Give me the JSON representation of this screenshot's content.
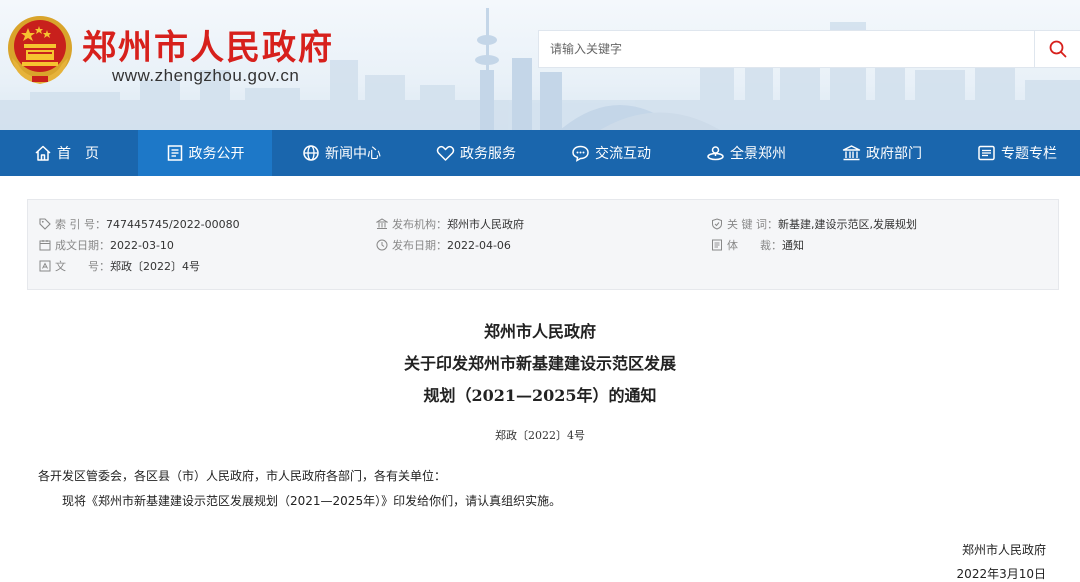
{
  "header": {
    "site_title": "郑州市人民政府",
    "site_url": "www.zhengzhou.gov.cn",
    "search_placeholder": "请输入关键字"
  },
  "nav": {
    "items": [
      {
        "label": "首　页",
        "icon": "home-icon"
      },
      {
        "label": "政务公开",
        "icon": "document-icon",
        "active": true
      },
      {
        "label": "新闻中心",
        "icon": "globe-icon"
      },
      {
        "label": "政务服务",
        "icon": "heart-icon"
      },
      {
        "label": "交流互动",
        "icon": "chat-icon"
      },
      {
        "label": "全景郑州",
        "icon": "panorama-icon"
      },
      {
        "label": "政府部门",
        "icon": "building-icon"
      },
      {
        "label": "专题专栏",
        "icon": "list-icon"
      }
    ]
  },
  "meta": {
    "index_label": "索 引 号：",
    "index_value": "747445745/2022-00080",
    "publisher_label": "发布机构：",
    "publisher_value": "郑州市人民政府",
    "keywords_label": "关 键 词：",
    "keywords_value": "新基建,建设示范区,发展规划",
    "created_label": "成文日期：",
    "created_value": "2022-03-10",
    "published_label": "发布日期：",
    "published_value": "2022-04-06",
    "genre_label": "体　　裁：",
    "genre_value": "通知",
    "docno_label": "文　　号：",
    "docno_value": "郑政〔2022〕4号"
  },
  "document": {
    "title_line1": "郑州市人民政府",
    "title_line2": "关于印发郑州市新基建建设示范区发展",
    "title_line3": "规划（2021—2025年）的通知",
    "number": "郑政〔2022〕4号",
    "salutation": "各开发区管委会，各区县（市）人民政府，市人民政府各部门，各有关单位：",
    "paragraph1": "现将《郑州市新基建建设示范区发展规划（2021—2025年）》印发给你们，请认真组织实施。",
    "signer": "郑州市人民政府",
    "date": "2022年3月10日"
  },
  "colors": {
    "brand_red": "#d7201c",
    "nav_blue": "#1a66ad",
    "nav_active": "#1d78c8"
  }
}
